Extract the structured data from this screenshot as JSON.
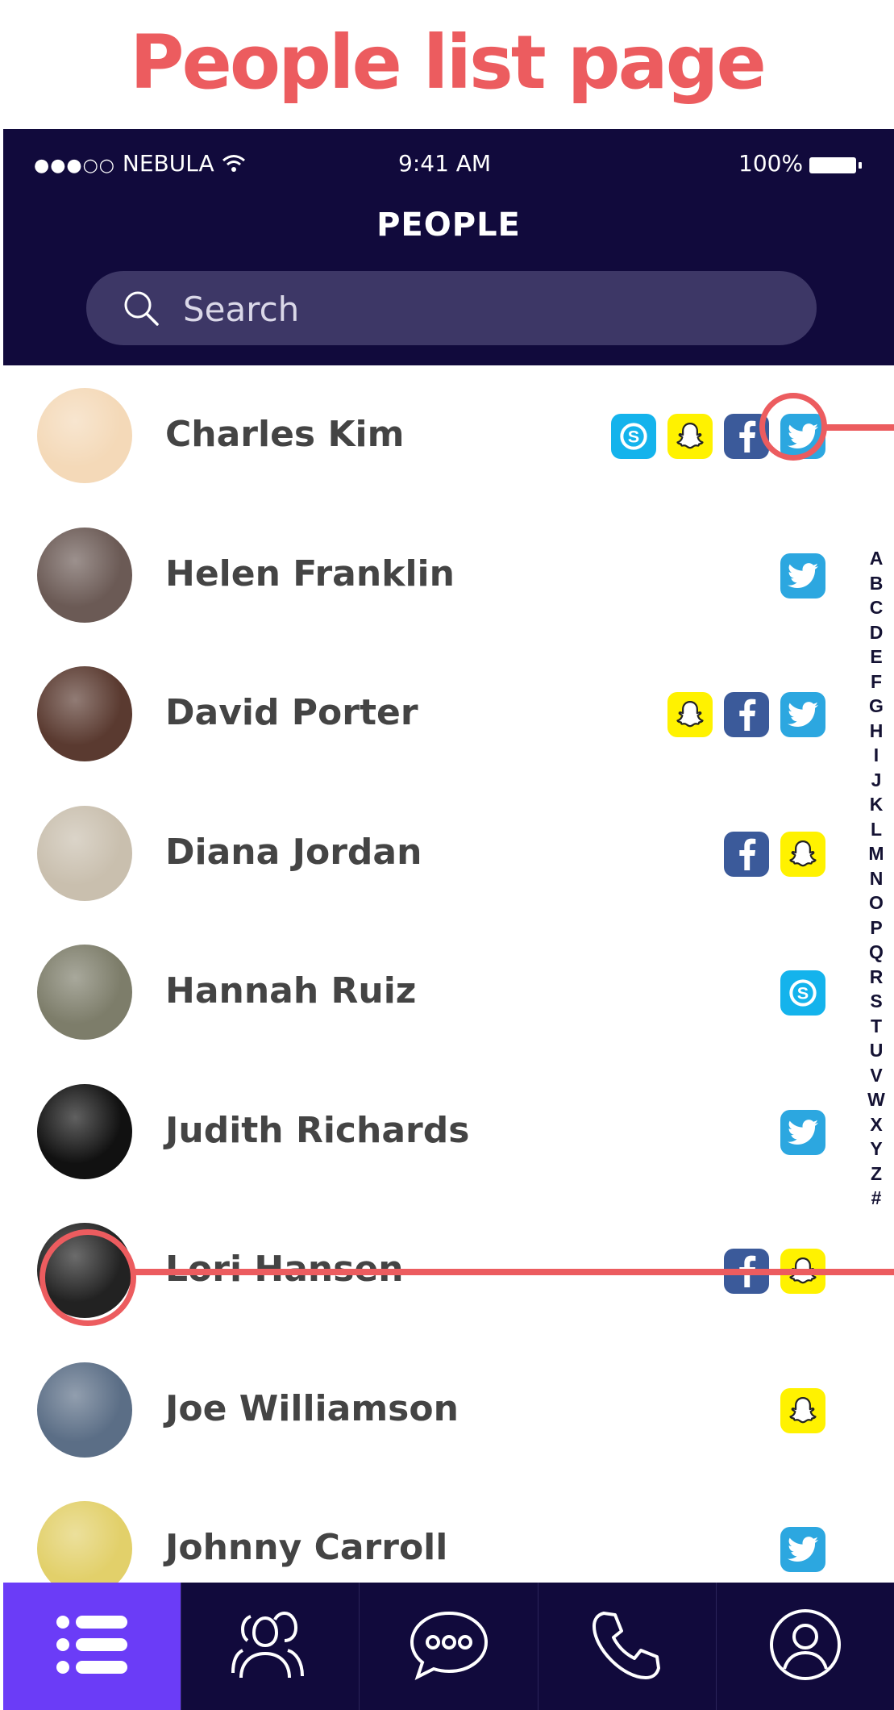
{
  "page_heading": "People list page",
  "status_bar": {
    "signal": "●●●○○",
    "carrier": "NEBULA",
    "time": "9:41 AM",
    "battery": "100%"
  },
  "header": {
    "title": "PEOPLE"
  },
  "search": {
    "placeholder": "Search",
    "value": ""
  },
  "people": [
    {
      "name": "Charles Kim",
      "avatar_color": "#F4D9B8",
      "icons": [
        "skype-icon",
        "snapchat-icon",
        "facebook-icon",
        "twitter-icon"
      ]
    },
    {
      "name": "Helen Franklin",
      "avatar_color": "#6B5A55",
      "icons": [
        "twitter-icon"
      ]
    },
    {
      "name": "David Porter",
      "avatar_color": "#5A3A30",
      "icons": [
        "snapchat-icon",
        "facebook-icon",
        "twitter-icon"
      ]
    },
    {
      "name": "Diana Jordan",
      "avatar_color": "#C9BFAE",
      "icons": [
        "facebook-icon",
        "snapchat-icon"
      ]
    },
    {
      "name": "Hannah Ruiz",
      "avatar_color": "#7D7D6A",
      "icons": [
        "skype-icon"
      ]
    },
    {
      "name": "Judith Richards",
      "avatar_color": "#111111",
      "icons": [
        "twitter-icon"
      ]
    },
    {
      "name": "Lori Hansen",
      "avatar_color": "#222222",
      "icons": [
        "facebook-icon",
        "snapchat-icon"
      ]
    },
    {
      "name": "Joe Williamson",
      "avatar_color": "#5B6E86",
      "icons": [
        "snapchat-icon"
      ]
    },
    {
      "name": "Johnny Carroll",
      "avatar_color": "#E2D06A",
      "icons": [
        "twitter-icon"
      ]
    }
  ],
  "alphabet_index": [
    "A",
    "B",
    "C",
    "D",
    "E",
    "F",
    "G",
    "H",
    "I",
    "J",
    "K",
    "L",
    "M",
    "N",
    "O",
    "P",
    "Q",
    "R",
    "S",
    "T",
    "U",
    "V",
    "W",
    "X",
    "Y",
    "Z",
    "#"
  ],
  "tabs": [
    {
      "icon": "list-icon",
      "active": true
    },
    {
      "icon": "people-icon",
      "active": false
    },
    {
      "icon": "chat-icon",
      "active": false
    },
    {
      "icon": "phone-icon",
      "active": false
    },
    {
      "icon": "profile-icon",
      "active": false
    }
  ],
  "colors": {
    "header_bg": "#110A3C",
    "accent_active_tab": "#6B3CF7",
    "annotation": "#EC5C5F",
    "twitter": "#2CA7E0",
    "facebook": "#3B5A9A",
    "snapchat": "#FFF200",
    "skype": "#14B3EC"
  }
}
